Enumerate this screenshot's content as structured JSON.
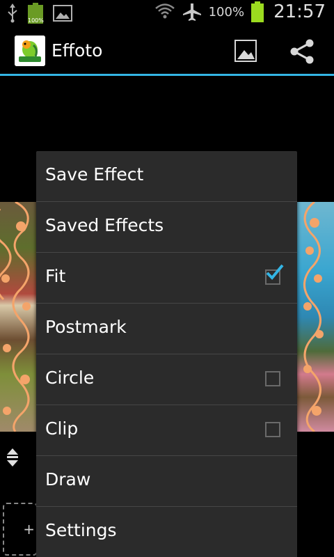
{
  "status_bar": {
    "left_icons": [
      "usb-icon",
      "battery-icon",
      "gallery-icon"
    ],
    "battery_small_label": "100%",
    "right_icons": [
      "wifi-icon",
      "airplane-mode-icon",
      "battery-icon"
    ],
    "battery_percent": "100%",
    "time": "21:57"
  },
  "action_bar": {
    "title": "Effoto",
    "logo_text": "effoto",
    "actions": [
      "gallery-icon",
      "share-icon"
    ],
    "accent_color": "#33b5e5"
  },
  "menu": {
    "items": [
      {
        "label": "Save Effect",
        "type": "action"
      },
      {
        "label": "Saved Effects",
        "type": "action"
      },
      {
        "label": "Fit",
        "type": "checkbox",
        "checked": true
      },
      {
        "label": "Postmark",
        "type": "action"
      },
      {
        "label": "Circle",
        "type": "checkbox",
        "checked": false
      },
      {
        "label": "Clip",
        "type": "checkbox",
        "checked": false
      },
      {
        "label": "Draw",
        "type": "action"
      },
      {
        "label": "Settings",
        "type": "action"
      }
    ]
  },
  "background": {
    "add_slot_symbol": "+",
    "icons": [
      "resize-handle-icon"
    ]
  }
}
